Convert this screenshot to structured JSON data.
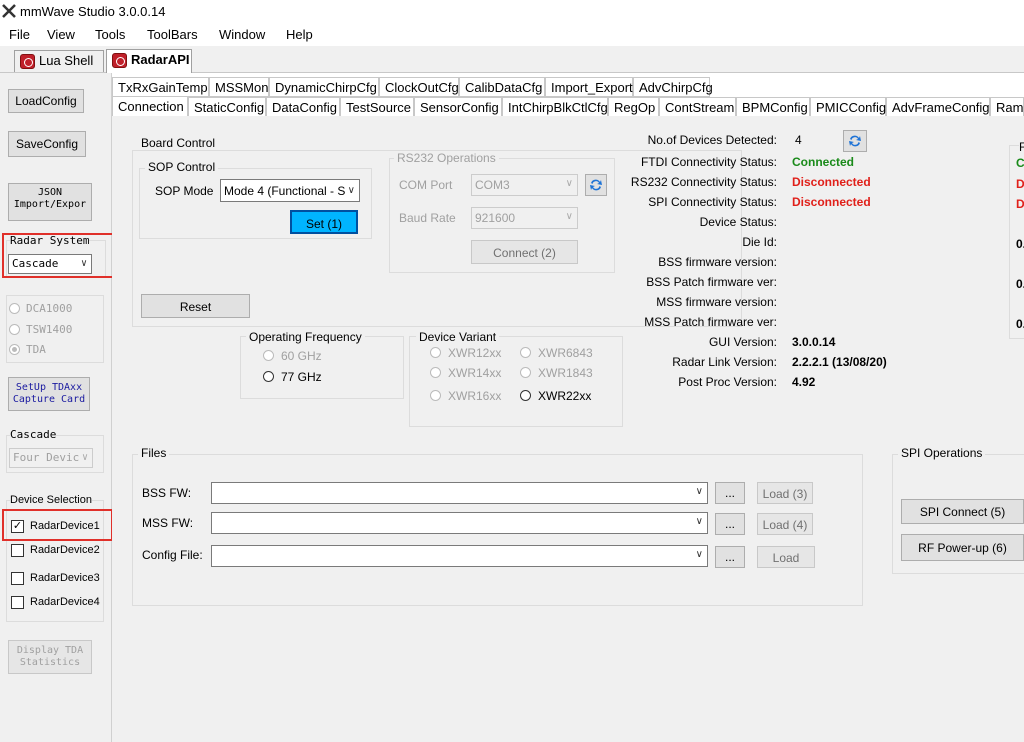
{
  "window": {
    "title": "mmWave Studio 3.0.0.14"
  },
  "menu": [
    "File",
    "View",
    "Tools",
    "ToolBars",
    "Window",
    "Help"
  ],
  "doc_tabs": [
    {
      "label": "Lua Shell"
    },
    {
      "label": "RadarAPI"
    }
  ],
  "sidebar": {
    "load_config": "LoadConfig",
    "save_config": "SaveConfig",
    "json_btn_line1": "JSON",
    "json_btn_line2": "Import/Expor",
    "radar_system_label": "Radar System",
    "radar_system_value": "Cascade",
    "radios": [
      "DCA1000",
      "TSW1400",
      "TDA"
    ],
    "setup_tda_line1": "SetUp TDAxx",
    "setup_tda_line2": "Capture Card",
    "cascade_label": "Cascade",
    "cascade_value": "Four Devic",
    "device_selection_label": "Device Selection",
    "devices": [
      "RadarDevice1",
      "RadarDevice2",
      "RadarDevice3",
      "RadarDevice4"
    ],
    "display_tda_line1": "Display TDA",
    "display_tda_line2": "Statistics"
  },
  "tabs_row1": [
    "TxRxGainTemp",
    "MSSMon",
    "DynamicChirpCfg",
    "ClockOutCfg",
    "CalibDataCfg",
    "Import_Export",
    "AdvChirpCfg"
  ],
  "tabs_row2": [
    "Connection",
    "StaticConfig",
    "DataConfig",
    "TestSource",
    "SensorConfig",
    "IntChirpBlkCtlCfg",
    "RegOp",
    "ContStream",
    "BPMConfig",
    "PMICConfig",
    "AdvFrameConfig",
    "Ram"
  ],
  "board_control": {
    "title": "Board Control",
    "sop_control": "SOP Control",
    "sop_mode_label": "SOP Mode",
    "sop_mode_value": "Mode 4 (Functional - S",
    "set_button": "Set (1)",
    "reset_button": "Reset"
  },
  "rs232": {
    "title": "RS232 Operations",
    "com_port_label": "COM Port",
    "com_port_value": "COM3",
    "baud_label": "Baud Rate",
    "baud_value": "921600",
    "connect_button": "Connect (2)"
  },
  "op_freq": {
    "title": "Operating Frequency",
    "options": [
      "60 GHz",
      "77 GHz"
    ]
  },
  "device_variant": {
    "title": "Device Variant",
    "options": [
      "XWR12xx",
      "XWR6843",
      "XWR14xx",
      "XWR1843",
      "XWR16xx",
      "XWR22xx"
    ]
  },
  "status": {
    "devices_detected_label": "No.of Devices Detected:",
    "devices_detected_value": "4",
    "rows": [
      {
        "label": "FTDI Connectivity Status:",
        "value": "Connected",
        "color": "#1a8a1a"
      },
      {
        "label": "RS232 Connectivity Status:",
        "value": "Disconnected",
        "color": "#e0201a"
      },
      {
        "label": "SPI Connectivity Status:",
        "value": "Disconnected",
        "color": "#e0201a"
      },
      {
        "label": "Device Status:",
        "value": ""
      },
      {
        "label": "Die Id:",
        "value": ""
      },
      {
        "label": "BSS firmware version:",
        "value": ""
      },
      {
        "label": "BSS Patch firmware ver:",
        "value": ""
      },
      {
        "label": "MSS firmware version:",
        "value": ""
      },
      {
        "label": "MSS Patch firmware ver:",
        "value": ""
      },
      {
        "label": "GUI Version:",
        "value": "3.0.0.14"
      },
      {
        "label": "Radar Link Version:",
        "value": "2.2.2.1 (13/08/20)"
      },
      {
        "label": "Post Proc Version:",
        "value": "4.92"
      }
    ],
    "right_edge": [
      "F",
      "C",
      "D",
      "D",
      "0.",
      "0.",
      "0."
    ]
  },
  "files": {
    "title": "Files",
    "bss_label": "BSS FW:",
    "mss_label": "MSS FW:",
    "config_label": "Config File:",
    "browse": "...",
    "load_bss": "Load (3)",
    "load_mss": "Load (4)",
    "load_config": "Load"
  },
  "spi": {
    "title": "SPI Operations",
    "connect": "SPI Connect (5)",
    "rf_power": "RF Power-up (6)"
  }
}
